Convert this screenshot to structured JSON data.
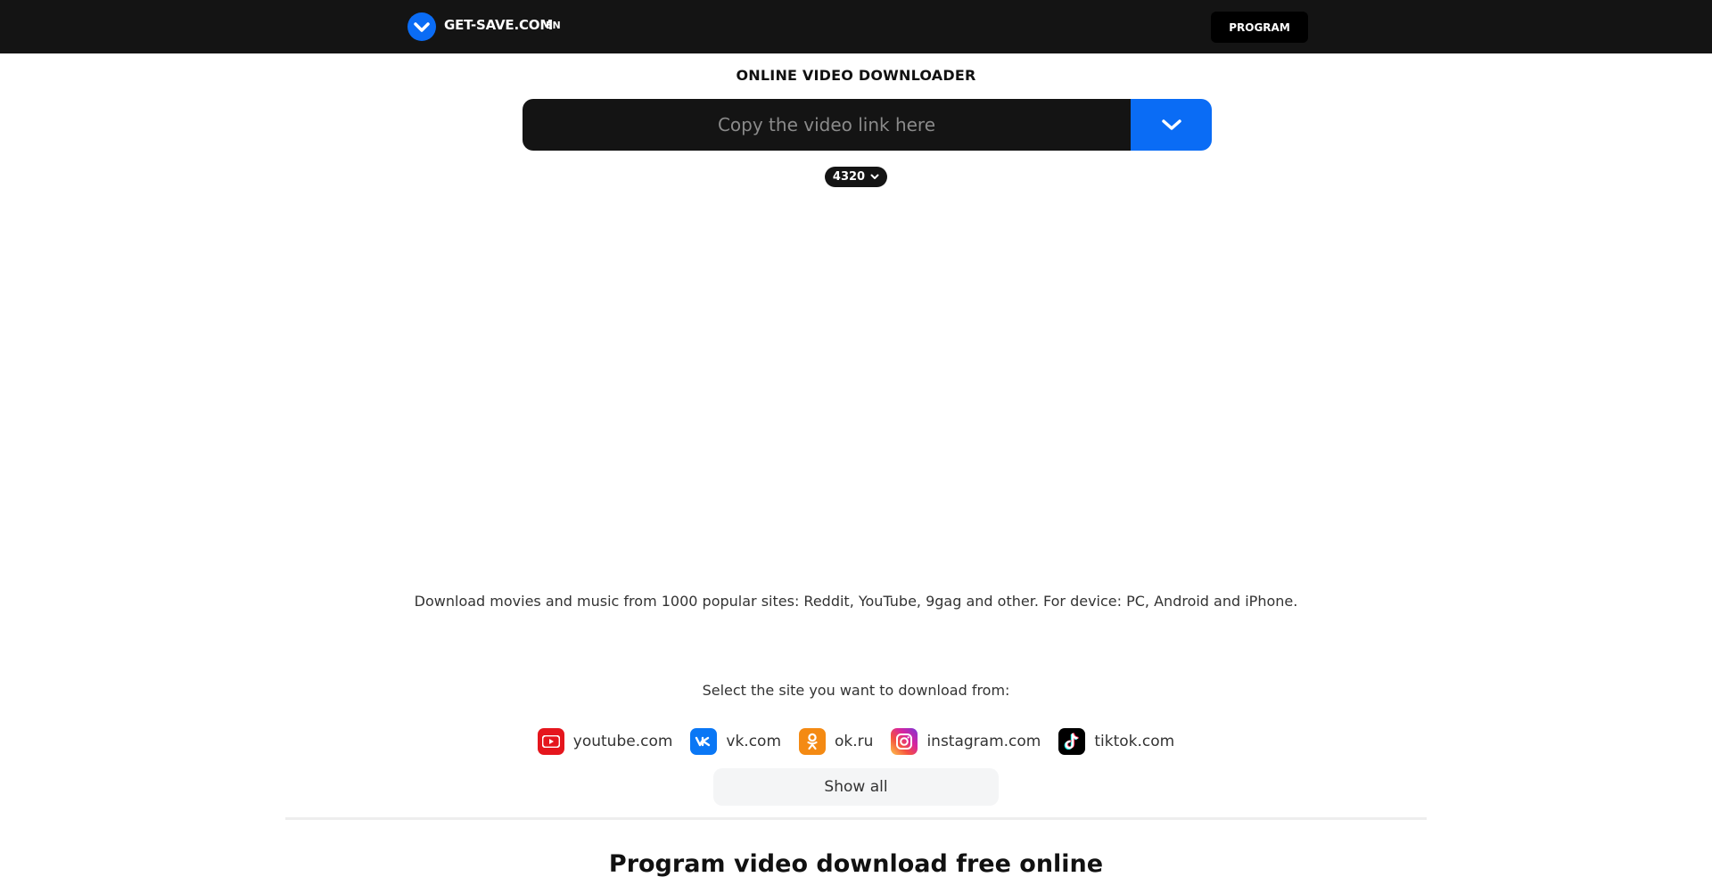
{
  "header": {
    "logo_text": "GET-SAVE.COM",
    "language": "EN",
    "program_label": "PROGRAM"
  },
  "main": {
    "title": "ONLINE VIDEO DOWNLOADER",
    "search": {
      "placeholder": "Copy the video link here",
      "value": ""
    },
    "quality": "4320",
    "description": "Download movies and music from 1000 popular sites: Reddit, YouTube, 9gag and other. For device: PC, Android and iPhone.",
    "select_label": "Select the site you want to download from:",
    "sites": [
      {
        "label": "youtube.com",
        "icon": "youtube-icon",
        "color": "#e5161d"
      },
      {
        "label": "vk.com",
        "icon": "vk-icon",
        "color": "#0a77f5"
      },
      {
        "label": "ok.ru",
        "icon": "ok-icon",
        "color": "#f48a13"
      },
      {
        "label": "instagram.com",
        "icon": "instagram-icon",
        "color": "#d6249f"
      },
      {
        "label": "tiktok.com",
        "icon": "tiktok-icon",
        "color": "#000000"
      }
    ],
    "show_all_label": "Show all",
    "section_title": "Program video download free online"
  },
  "colors": {
    "accent": "#0a6cf5",
    "dark": "#141414"
  }
}
